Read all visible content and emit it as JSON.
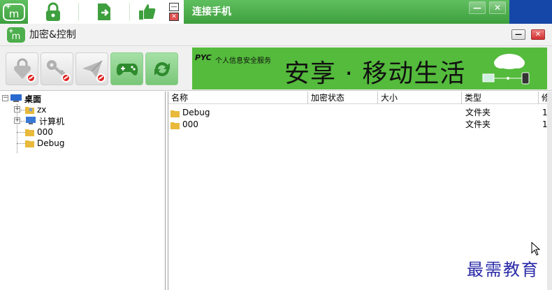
{
  "topbar": {
    "title": "连接手机",
    "min_label": "—",
    "close_label": "✕"
  },
  "window": {
    "title": "加密&控制",
    "min_label": "—",
    "close_label": "✕"
  },
  "banner": {
    "logo": "PYC",
    "service": "个人信息安全服务",
    "slogan": "安享 · 移动生活"
  },
  "tree": {
    "root": "桌面",
    "items": [
      {
        "label": "zx"
      },
      {
        "label": "计算机"
      },
      {
        "label": "000"
      },
      {
        "label": "Debug"
      }
    ]
  },
  "list": {
    "columns": [
      "名称",
      "加密状态",
      "大小",
      "类型",
      "修"
    ],
    "rows": [
      {
        "name": "Debug",
        "type": "文件夹",
        "extra": "1"
      },
      {
        "name": "000",
        "type": "文件夹",
        "extra": "1"
      }
    ]
  },
  "watermark": "最需教育",
  "colors": {
    "accent_green": "#4cae4c",
    "banner_green": "#54bb3c",
    "blue": "#1547a8"
  }
}
